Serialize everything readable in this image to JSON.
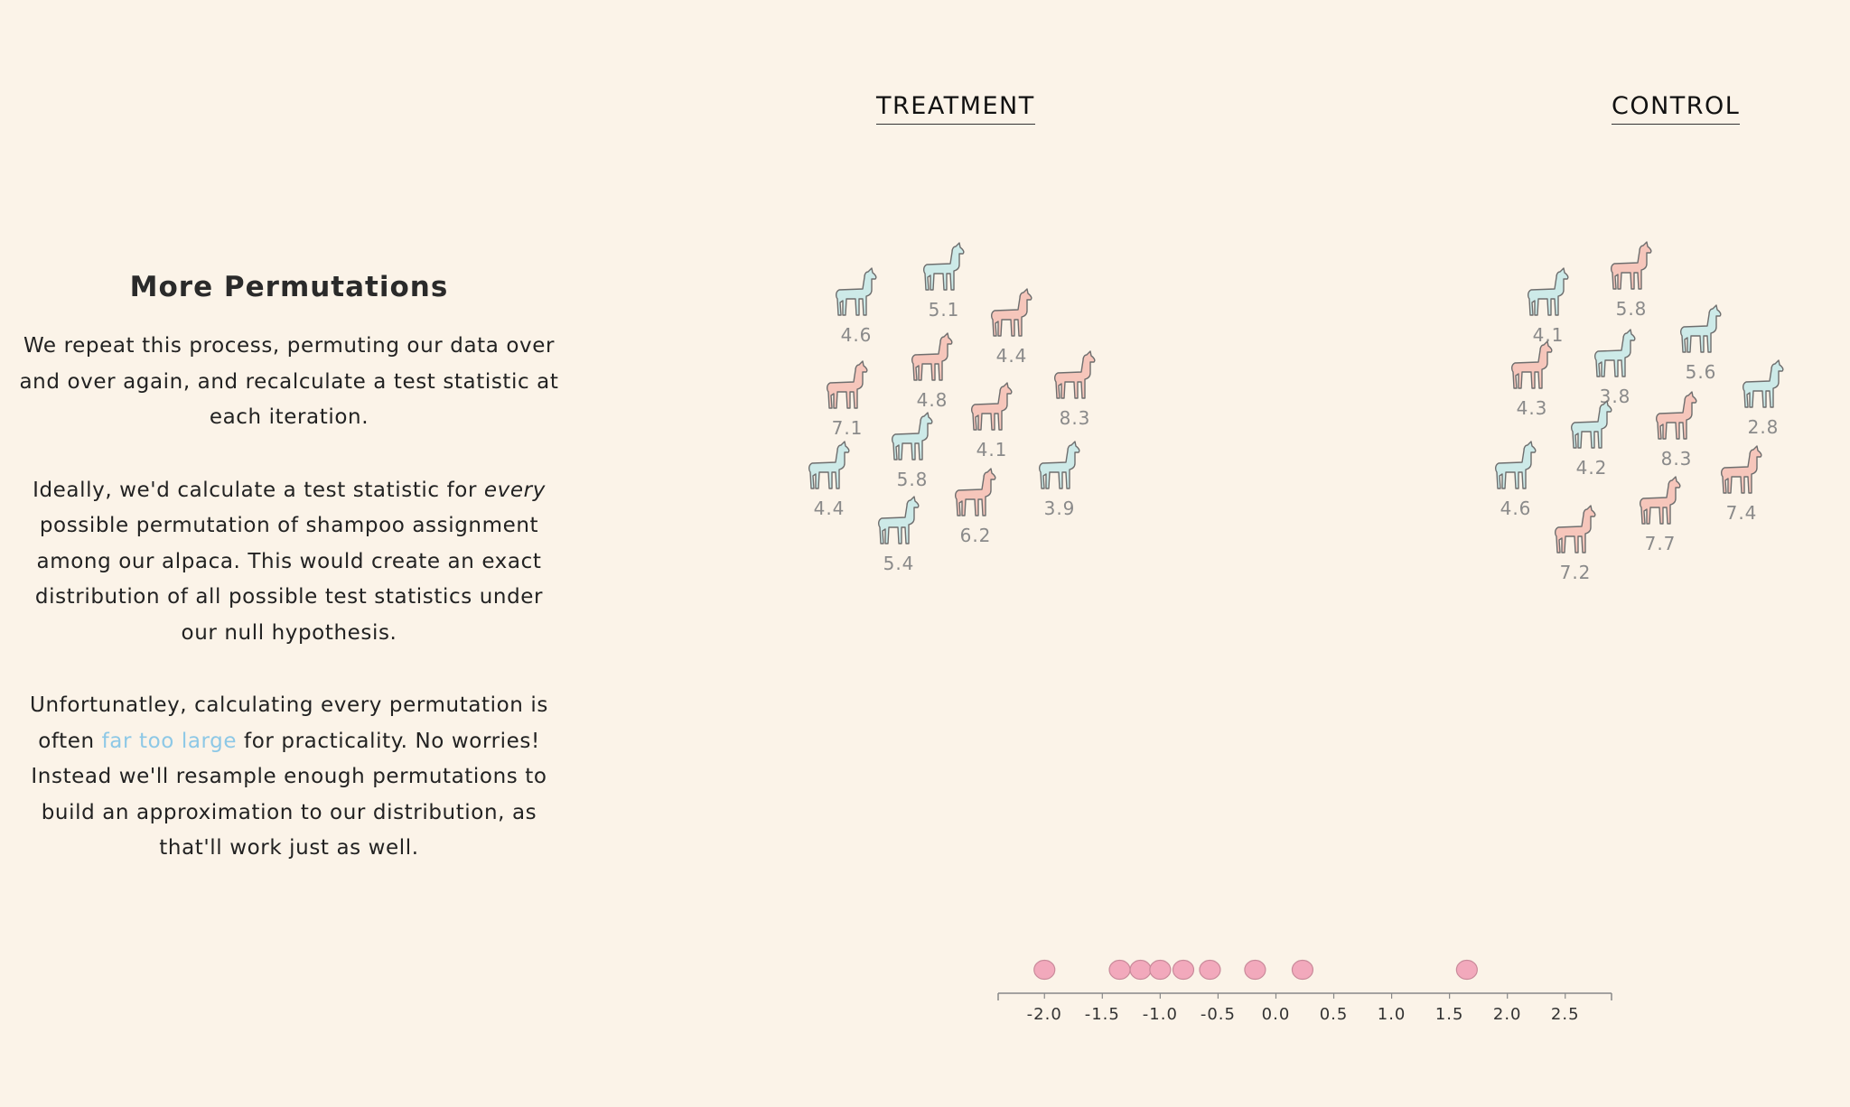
{
  "panel": {
    "title": "More Permutations",
    "p1": "We repeat this process, permuting our data over and over again, and recalculate a test statistic at each iteration.",
    "p2_em": "every",
    "p2_before": "Ideally, we'd calculate a test statistic for ",
    "p2_after": " possible permutation of shampoo assignment among our alpaca. This would create an exact distribution of all possible test statistics under our null hypothesis.",
    "p3_before": "Unfortunatley, calculating every permutation is often ",
    "p3_link": "far too large",
    "p3_after": " for practicality. No worries! Instead we'll resample enough permutations to build an approximation to our distribution, as that'll work just as well."
  },
  "groups": {
    "treatment_label": "TREATMENT",
    "control_label": "CONTROL"
  },
  "colors": {
    "blue_alpaca": "#cdeae8",
    "pink_alpaca": "#f6c6bb",
    "dot": "#f2a9bc",
    "link": "#8dc8e6",
    "value_text": "#8a8a8a"
  },
  "treatment_alpacas": [
    {
      "value": "4.6",
      "color": "blue"
    },
    {
      "value": "5.1",
      "color": "blue"
    },
    {
      "value": "4.4",
      "color": "pink"
    },
    {
      "value": "7.1",
      "color": "pink"
    },
    {
      "value": "4.8",
      "color": "pink"
    },
    {
      "value": "8.3",
      "color": "pink"
    },
    {
      "value": "4.1",
      "color": "pink"
    },
    {
      "value": "4.4",
      "color": "blue"
    },
    {
      "value": "5.8",
      "color": "blue"
    },
    {
      "value": "3.9",
      "color": "blue"
    },
    {
      "value": "6.2",
      "color": "pink"
    },
    {
      "value": "5.4",
      "color": "blue"
    }
  ],
  "control_alpacas": [
    {
      "value": "4.1",
      "color": "blue"
    },
    {
      "value": "5.8",
      "color": "pink"
    },
    {
      "value": "5.6",
      "color": "blue"
    },
    {
      "value": "4.3",
      "color": "pink"
    },
    {
      "value": "3.8",
      "color": "blue"
    },
    {
      "value": "2.8",
      "color": "blue"
    },
    {
      "value": "8.3",
      "color": "pink"
    },
    {
      "value": "4.2",
      "color": "blue"
    },
    {
      "value": "4.6",
      "color": "blue"
    },
    {
      "value": "7.4",
      "color": "pink"
    },
    {
      "value": "7.7",
      "color": "pink"
    },
    {
      "value": "7.2",
      "color": "pink"
    }
  ],
  "chart_data": {
    "type": "scatter",
    "title": "",
    "xlabel": "",
    "ylabel": "",
    "x_ticks": [
      "-2.0",
      "-1.5",
      "-1.0",
      "-0.5",
      "0.0",
      "0.5",
      "1.0",
      "1.5",
      "2.0",
      "2.5"
    ],
    "xlim": [
      -2.4,
      2.9
    ],
    "grid": false,
    "points": [
      -2.0,
      -1.35,
      -1.17,
      -1.0,
      -0.8,
      -0.57,
      -0.18,
      0.23,
      1.65
    ]
  }
}
